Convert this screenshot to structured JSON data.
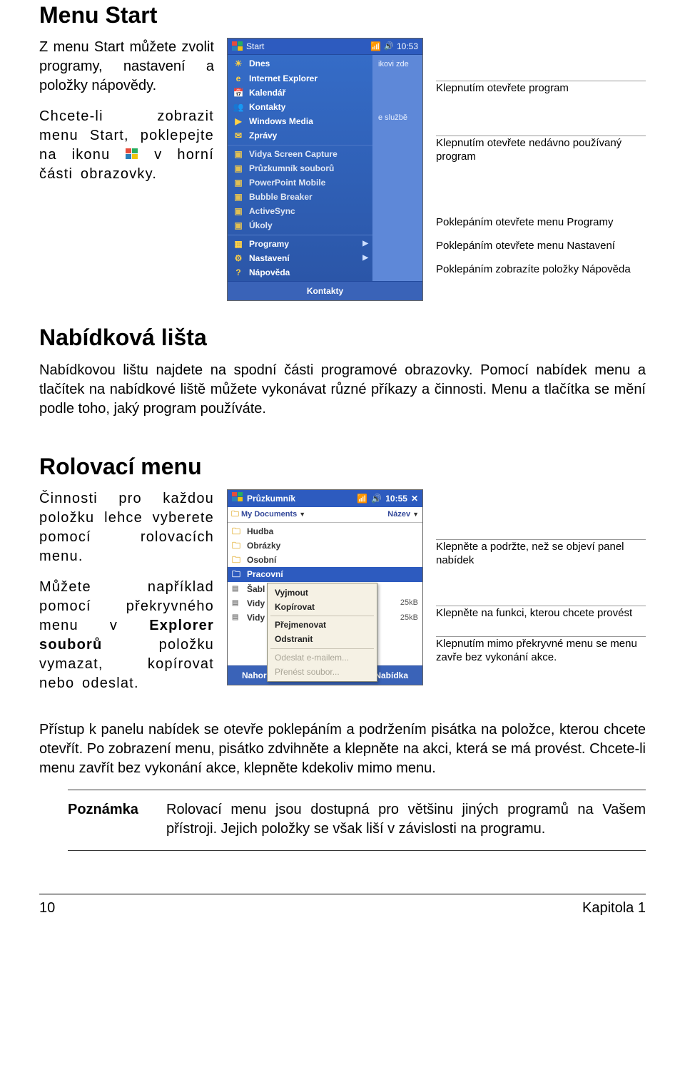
{
  "section1": {
    "heading": "Menu Start",
    "para1": "Z menu Start můžete zvolit programy, nastavení a položky nápovědy.",
    "para2a": "Chcete-li zobrazit menu Start, poklepejte na ikonu ",
    "para2b": " v horní části obrazovky."
  },
  "start_shot": {
    "title": "Start",
    "time": "10:53",
    "items": [
      "Dnes",
      "Internet Explorer",
      "Kalendář",
      "Kontakty",
      "Windows Media",
      "Zprávy"
    ],
    "recent": [
      "Vidya Screen Capture",
      "Průzkumník souborů",
      "PowerPoint Mobile",
      "Bubble Breaker",
      "ActiveSync",
      "Úkoly"
    ],
    "system": [
      "Programy",
      "Nastavení",
      "Nápověda"
    ],
    "right_panel_hint": "ikovi zde",
    "right_panel_line2": "e službě",
    "bottom": "Kontakty"
  },
  "start_callouts": {
    "c1": "Klepnutím otevřete program",
    "c2": "Klepnutím otevřete nedávno používaný program",
    "c3a": "Poklepáním otevřete menu Programy",
    "c3b": "Poklepáním otevřete menu Nastavení",
    "c3c": "Poklepáním zobrazíte položky Nápověda"
  },
  "section2": {
    "heading": "Nabídková lišta",
    "para": "Nabídkovou lištu najdete na spodní části programové obrazovky. Pomocí nabídek menu a tlačítek na nabídkové liště můžete vykonávat různé příkazy a činnosti. Menu a tlačítka se mění podle toho, jaký program používáte."
  },
  "section3": {
    "heading": "Rolovací menu",
    "para1": "Činnosti pro každou položku lehce vyberete pomocí rolovacích menu.",
    "para2a": "Můžete například pomocí překryvného menu v ",
    "para2b": "Explorer souborů",
    "para2c": " položku vymazat, kopírovat nebo odeslat."
  },
  "explorer_shot": {
    "title": "Průzkumník",
    "time": "10:55",
    "loc_label": "My Documents",
    "col_head": "Název",
    "folders": [
      "Hudba",
      "Obrázky",
      "Osobní"
    ],
    "sel_folder": "Pracovní",
    "files": [
      {
        "name": "Šabl",
        "size": ""
      },
      {
        "name": "Vidy",
        "size": "25kB"
      },
      {
        "name": "Vidy",
        "size": "25kB"
      }
    ],
    "ctx": [
      "Vyjmout",
      "Kopírovat",
      "Přejmenovat",
      "Odstranit"
    ],
    "ctx_disabled": [
      "Odeslat e-mailem...",
      "Přenést soubor..."
    ],
    "bottom_left": "Nahoru",
    "bottom_right": "Nabídka"
  },
  "explorer_callouts": {
    "c1": "Klepněte a podržte, než se objeví panel nabídek",
    "c2": "Klepněte na funkci, kterou chcete provést",
    "c3": "Klepnutím mimo překryvné menu se menu zavře bez vykonání akce."
  },
  "after_para": "Přístup k panelu nabídek se otevře poklepáním a podržením pisátka na položce, kterou chcete otevřít. Po zobrazení menu, pisátko zdvihněte a klepněte na akci, která se má provést. Chcete-li menu zavřít bez vykonání akce, klepněte kdekoliv mimo menu.",
  "note": {
    "label": "Poznámka",
    "body": "Rolovací menu jsou dostupná pro většinu jiných programů na Vašem přístroji. Jejich položky se však liší v závislosti na programu."
  },
  "footer": {
    "page": "10",
    "chapter": "Kapitola 1"
  }
}
